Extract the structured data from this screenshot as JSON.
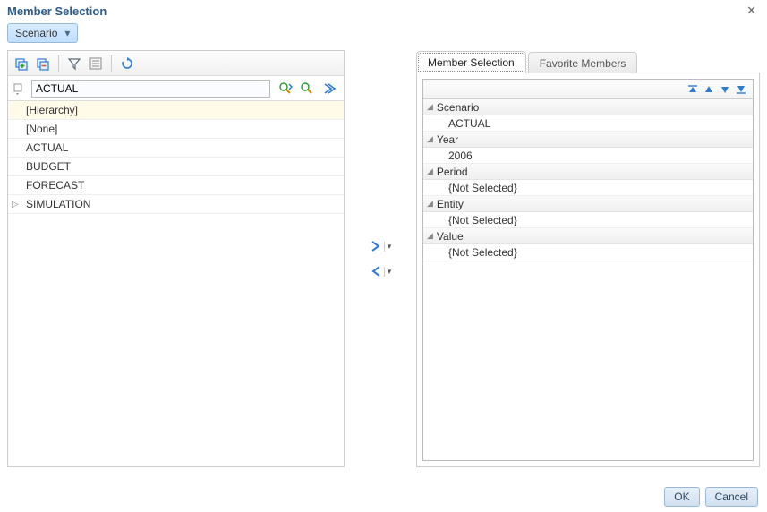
{
  "dialog_title": "Member Selection",
  "dimension_dropdown": {
    "label": "Scenario"
  },
  "left_panel": {
    "toolbar_icons": {
      "select_plus": "select-plus-icon",
      "deselect": "deselect-icon",
      "filter": "filter-icon",
      "list": "list-icon",
      "refresh": "refresh-icon"
    },
    "search_value": "ACTUAL",
    "tree_items": [
      {
        "label": "[Hierarchy]",
        "selected": true,
        "expandable": false
      },
      {
        "label": "[None]",
        "selected": false,
        "expandable": false
      },
      {
        "label": "ACTUAL",
        "selected": false,
        "expandable": false
      },
      {
        "label": "BUDGET",
        "selected": false,
        "expandable": false
      },
      {
        "label": "FORECAST",
        "selected": false,
        "expandable": false
      },
      {
        "label": "SIMULATION",
        "selected": false,
        "expandable": true
      }
    ]
  },
  "tabs": [
    {
      "label": "Member Selection",
      "active": true
    },
    {
      "label": "Favorite Members",
      "active": false
    }
  ],
  "selection_groups": [
    {
      "name": "Scenario",
      "value": "ACTUAL"
    },
    {
      "name": "Year",
      "value": "2006"
    },
    {
      "name": "Period",
      "value": "{Not Selected}"
    },
    {
      "name": "Entity",
      "value": "{Not Selected}"
    },
    {
      "name": "Value",
      "value": "{Not Selected}"
    }
  ],
  "buttons": {
    "ok": "OK",
    "cancel": "Cancel"
  }
}
